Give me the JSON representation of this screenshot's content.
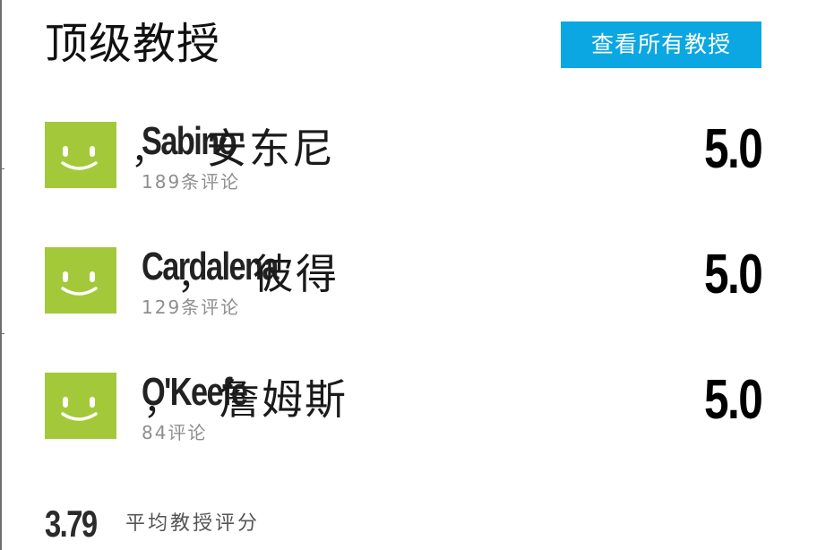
{
  "section": {
    "title": "顶级教授",
    "view_all_label": "查看所有教授"
  },
  "professors": [
    {
      "last_name": "Sabino",
      "separator": "，",
      "first_name": "安东尼",
      "reviews": "189条评论",
      "rating": "5.0",
      "avatar_icon": "smiley-face-icon"
    },
    {
      "last_name": "Cardalena",
      "separator": "，",
      "first_name": "彼得",
      "reviews": "129条评论",
      "rating": "5.0",
      "avatar_icon": "smiley-face-icon"
    },
    {
      "last_name": "O'Keefe",
      "separator": "，",
      "first_name": "詹姆斯",
      "reviews": "84评论",
      "rating": "5.0",
      "avatar_icon": "smiley-face-icon"
    }
  ],
  "average": {
    "value": "3.79",
    "label": "平均教授评分"
  },
  "colors": {
    "accent_button": "#0ba7e3",
    "avatar_green": "#a3c93a",
    "review_gray": "#8e8e8e"
  }
}
